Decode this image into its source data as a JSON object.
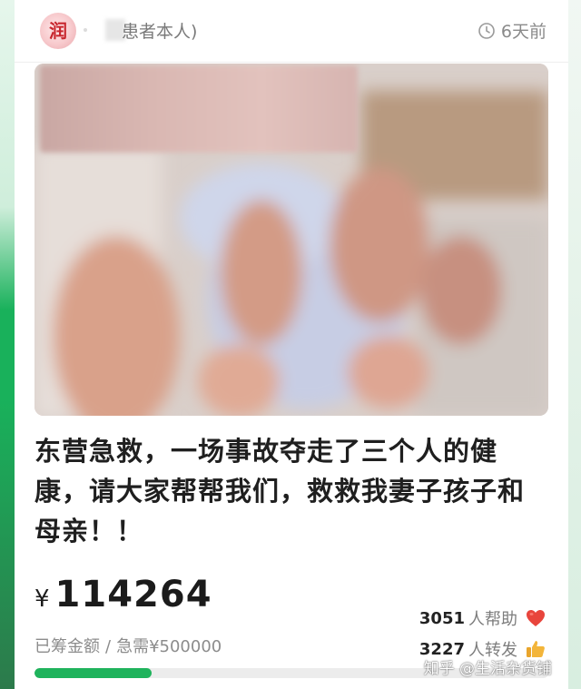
{
  "header": {
    "avatar_logo_text": "润",
    "name_suffix": "患者本人)",
    "time_text": "6天前"
  },
  "title": "东营急救，一场事故夺走了三个人的健康，请大家帮帮我们，救救我妻子孩子和母亲！！",
  "amount": {
    "currency": "¥",
    "value": "114264"
  },
  "raised": {
    "label": "已筹金额",
    "separator": "/",
    "need_text": "急需¥500000"
  },
  "stats": {
    "helpers_count": "3051",
    "helpers_label": "人帮助",
    "shares_count": "3227",
    "shares_label": "人转发"
  },
  "progress": {
    "raised": 114264,
    "goal": 500000
  },
  "watermark": "知乎 @生活杂货铺",
  "colors": {
    "accent_green": "#1fb35c",
    "heart_red": "#e8453c",
    "thumb_yellow": "#f3b53a"
  },
  "icons": {
    "time": "clock-icon",
    "helpers": "heart-icon",
    "shares": "thumbs-up-icon"
  }
}
